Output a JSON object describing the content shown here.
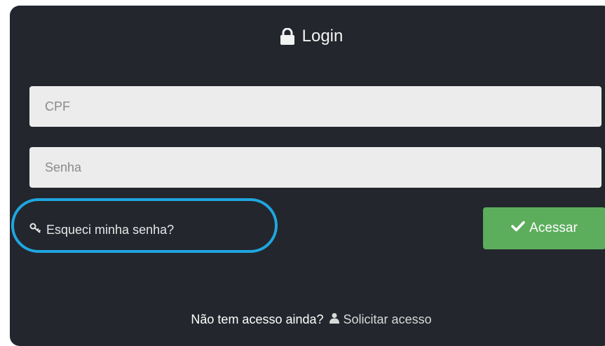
{
  "login": {
    "title": "Login",
    "title_icon": "lock-icon",
    "cpf_placeholder": "CPF",
    "senha_placeholder": "Senha",
    "forgot_label": "Esqueci minha senha?",
    "forgot_icon": "key-icon",
    "submit_label": "Acessar",
    "submit_icon": "check-icon",
    "footer_text": "Não tem acesso ainda?",
    "request_label": "Solicitar acesso",
    "request_icon": "user-icon"
  },
  "colors": {
    "panel_bg": "#23262d",
    "input_bg": "#ececec",
    "button_green": "#5cad5c",
    "highlight_blue": "#1fa6e0"
  }
}
